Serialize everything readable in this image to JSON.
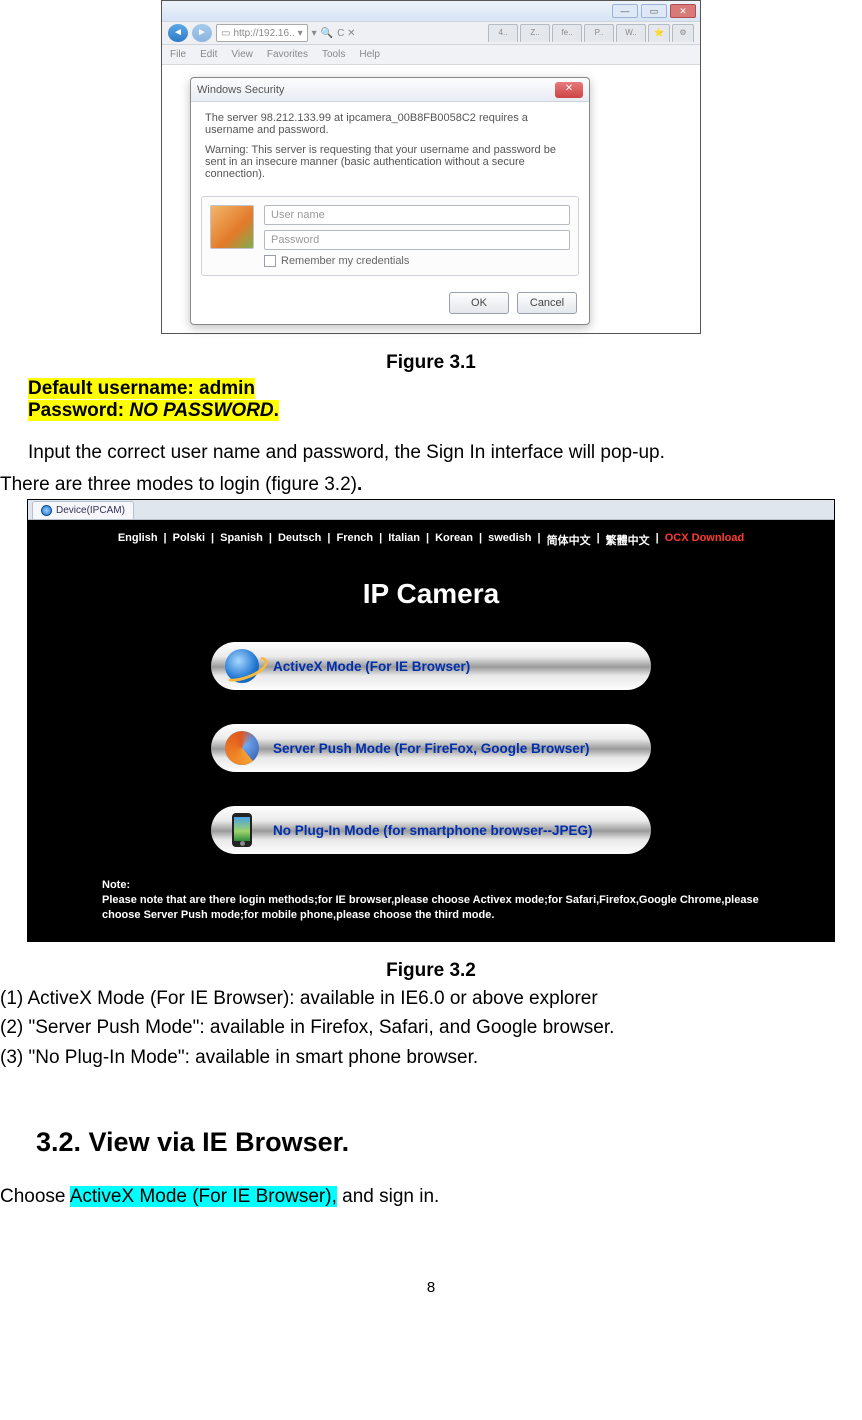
{
  "fig1": {
    "url_text": "http://192.16..",
    "menus": [
      "File",
      "Edit",
      "View",
      "Favorites",
      "Tools",
      "Help"
    ],
    "tabs": [
      "4..",
      "Z..",
      "fe..",
      "P..",
      "W..",
      "S"
    ],
    "dialog_title": "Windows Security",
    "msg1": "The server 98.212.133.99 at ipcamera_00B8FB0058C2 requires a username and password.",
    "msg2": "Warning: This server is requesting that your username and password be sent in an insecure manner (basic authentication without a secure connection).",
    "ph_user": "User name",
    "ph_pass": "Password",
    "remember": "Remember my credentials",
    "ok": "OK",
    "cancel": "Cancel"
  },
  "captions": {
    "fig1": "Figure 3.1",
    "fig2": "Figure 3.2"
  },
  "creds": {
    "line1": " Default username: admin",
    "line2": "Password: ",
    "line2b": "NO PASSWORD",
    "line2c": "."
  },
  "para1a": "Input the correct user name and password, the Sign In interface will pop-up.",
  "para1b": "There are three modes to login (figure 3.2)",
  "para1c": ".",
  "fig2": {
    "tab": "Device(IPCAM)",
    "langs": [
      "English",
      "Polski",
      "Spanish",
      "Deutsch",
      "French",
      "Italian",
      "Korean",
      "swedish",
      "简体中文",
      "繁體中文"
    ],
    "ocx": "OCX Download",
    "title": "IP Camera",
    "mode1": "ActiveX Mode (For IE Browser)",
    "mode2": "Server Push Mode (For FireFox, Google Browser)",
    "mode3": "No Plug-In Mode (for smartphone browser--JPEG)",
    "note_label": "Note:",
    "note_body": "Please note that are there login methods;for IE browser,please choose Activex mode;for Safari,Firefox,Google Chrome,please choose Server Push mode;for mobile phone,please choose the third mode."
  },
  "list": {
    "l1": "(1) ActiveX Mode (For IE Browser): available in IE6.0 or above explorer",
    "l2": "(2) \"Server Push Mode\": available in Firefox, Safari, and Google browser.",
    "l3": "(3) \"No Plug-In Mode\": available in smart phone browser."
  },
  "section": "3.2.  View via IE Browser.",
  "final": {
    "a": "Choose ",
    "b": "ActiveX  Mode (For IE Browser),",
    "c": " and sign in."
  },
  "page": "8"
}
